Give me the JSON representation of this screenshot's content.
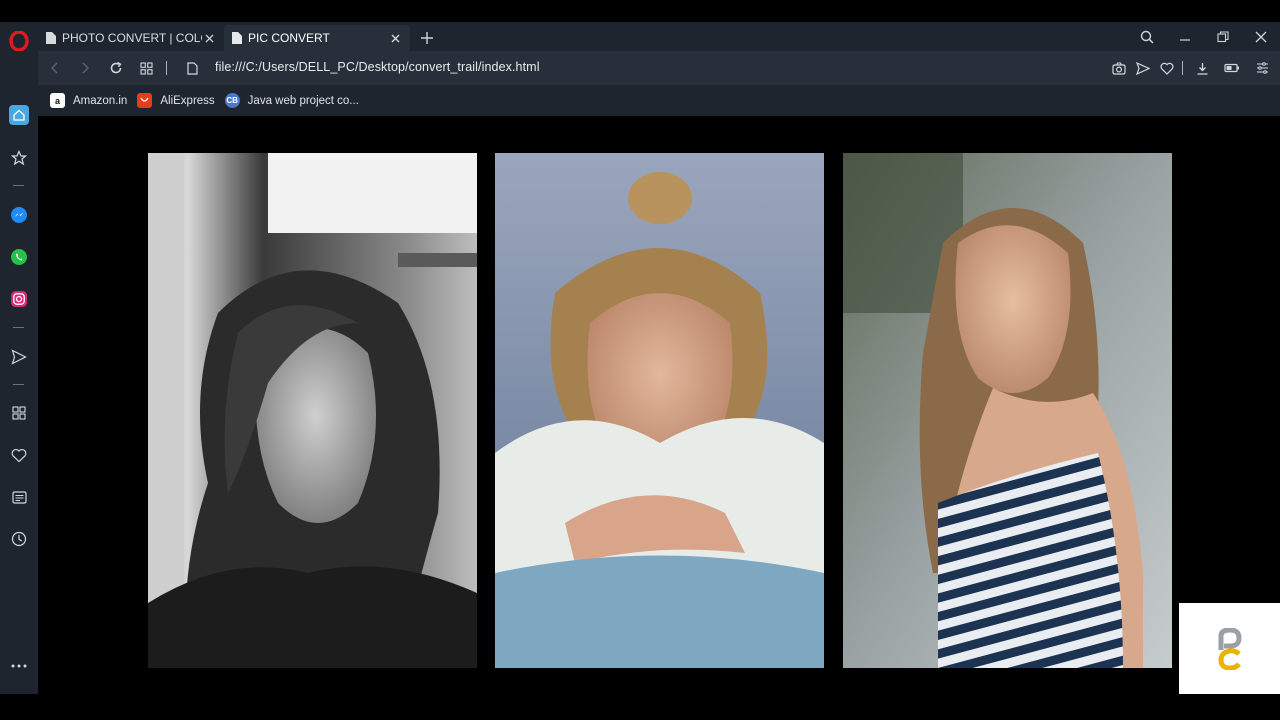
{
  "browser": {
    "tabs": [
      {
        "title": "PHOTO CONVERT | COLOUR",
        "active": false
      },
      {
        "title": "PIC CONVERT",
        "active": true
      }
    ],
    "address": "file:///C:/Users/DELL_PC/Desktop/convert_trail/index.html",
    "bookmarks": [
      {
        "label": "Amazon.in",
        "icon": "amazon-icon"
      },
      {
        "label": "AliExpress",
        "icon": "aliexpress-icon"
      },
      {
        "label": "Java web project co...",
        "icon": "cb-icon",
        "icon_text": "CB"
      }
    ]
  },
  "sidebar": {
    "items": [
      "home-icon",
      "star-icon",
      "messenger-icon",
      "whatsapp-icon",
      "instagram-icon",
      "send-icon",
      "grid-icon",
      "heart-icon",
      "news-icon",
      "history-icon",
      "more-icon"
    ]
  },
  "gallery": {
    "photos": [
      {
        "description": "Black and white portrait"
      },
      {
        "description": "Woman leaning on arms, white sweater"
      },
      {
        "description": "Woman in striped top"
      }
    ]
  },
  "colors": {
    "chrome": "#1e252e",
    "addressbar": "#27303a",
    "opera_red": "#e11a22",
    "sidebar_active": "#4aa8e0"
  }
}
